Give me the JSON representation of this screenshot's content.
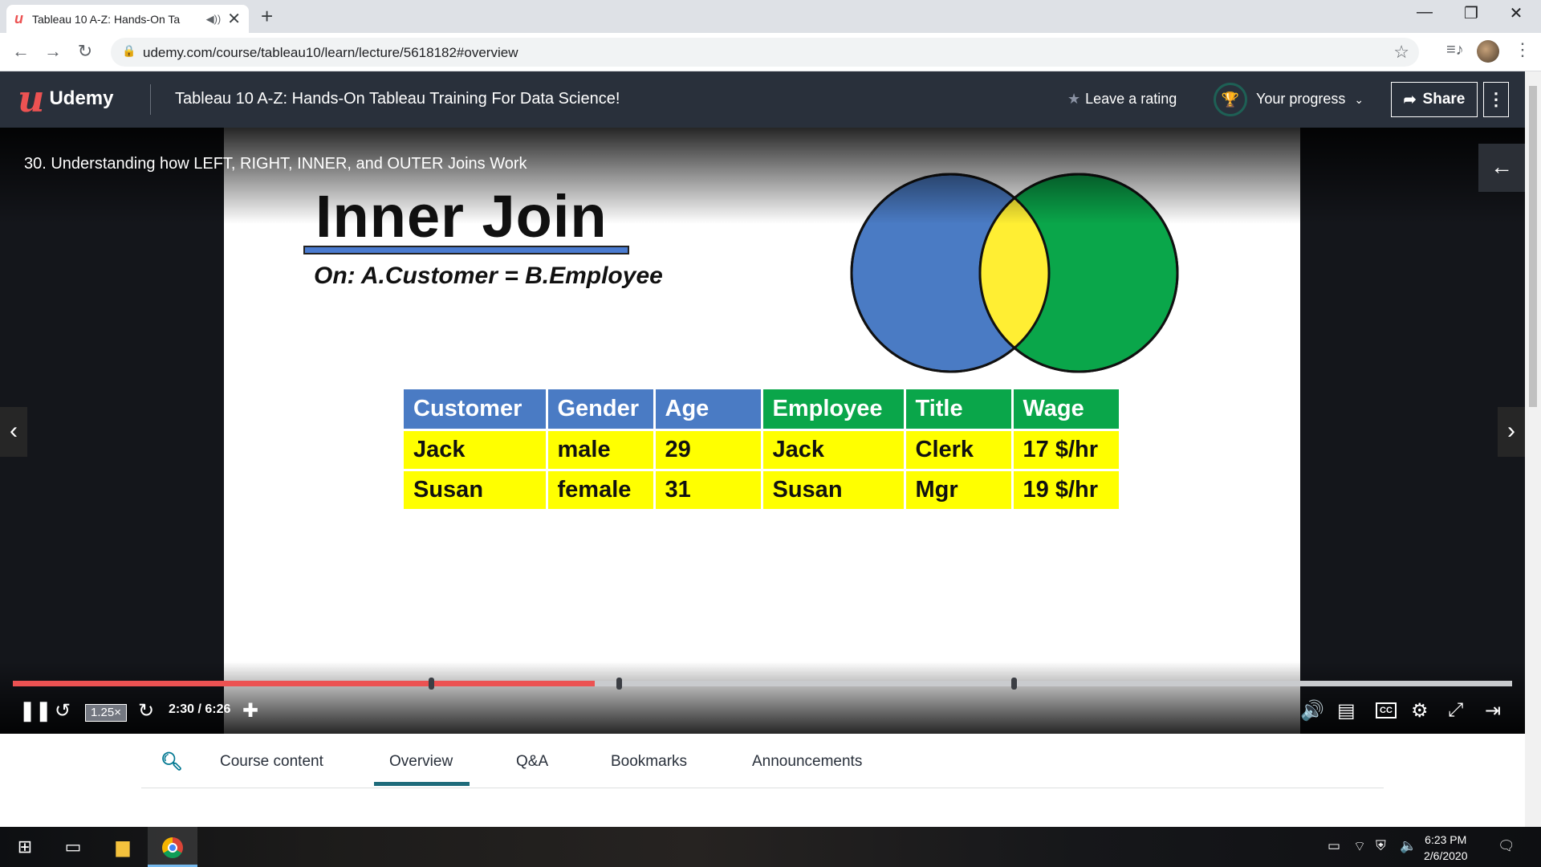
{
  "browser": {
    "tab_title": "Tableau 10 A-Z: Hands-On Ta",
    "url": "udemy.com/course/tableau10/learn/lecture/5618182#overview"
  },
  "header": {
    "logo_text": "Udemy",
    "course_title": "Tableau 10 A-Z: Hands-On Tableau Training For Data Science!",
    "rating_label": "Leave a rating",
    "progress_label": "Your progress",
    "share_label": "Share"
  },
  "player": {
    "lecture_title": "30. Understanding how LEFT, RIGHT, INNER, and OUTER Joins Work",
    "rate": "1.25×",
    "time": "2:30 / 6:26",
    "progress_fraction": 0.388
  },
  "slide": {
    "heading": "Inner Join",
    "subheading": "On: A.Customer = B.Employee",
    "table": {
      "headers": [
        "Customer",
        "Gender",
        "Age",
        "Employee",
        "Title",
        "Wage"
      ],
      "rows": [
        [
          "Jack",
          "male",
          "29",
          "Jack",
          "Clerk",
          "17 $/hr"
        ],
        [
          "Susan",
          "female",
          "31",
          "Susan",
          "Mgr",
          "19 $/hr"
        ]
      ]
    },
    "colors": {
      "table_a_header": "#4a7bc4",
      "table_b_header": "#0aa64a",
      "row_highlight": "#ffff00",
      "venn_left": "#4a7bc4",
      "venn_right": "#0aa64a",
      "venn_overlap": "#ffee33"
    }
  },
  "lecture_tabs": [
    "Course content",
    "Overview",
    "Q&A",
    "Bookmarks",
    "Announcements"
  ],
  "active_tab": "Overview",
  "taskbar": {
    "time": "6:23 PM",
    "date": "2/6/2020"
  }
}
